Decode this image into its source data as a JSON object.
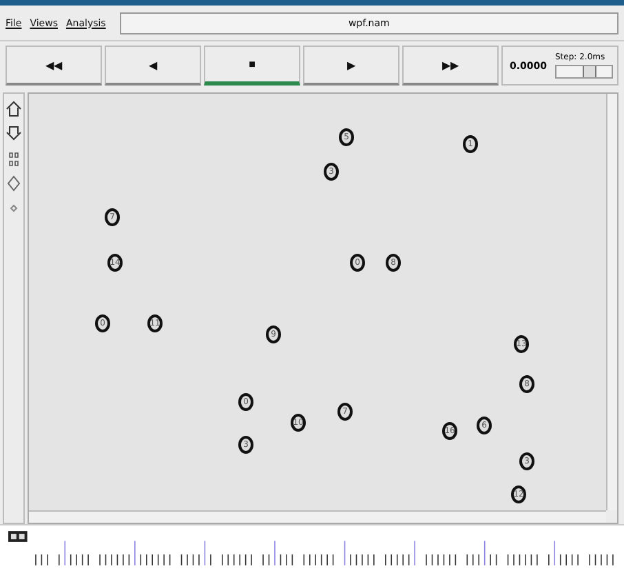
{
  "menu": [
    "File",
    "Views",
    "Analysis"
  ],
  "title": "wpf.nam",
  "controls": [
    {
      "symbol": "◀◀",
      "selected": false
    },
    {
      "symbol": "◀",
      "selected": false
    },
    {
      "symbol": "■",
      "selected": true
    },
    {
      "symbol": "▶",
      "selected": false
    },
    {
      "symbol": "▶▶",
      "selected": false
    }
  ],
  "time": "0.0000",
  "step": {
    "label": "Step: 2.0ms",
    "level": 0.6
  },
  "nodes": [
    {
      "label": "5"
    },
    {
      "label": "1"
    },
    {
      "label": "3"
    },
    {
      "label": "7"
    },
    {
      "label": "14"
    },
    {
      "label": "0"
    },
    {
      "label": "8"
    },
    {
      "label": "0"
    },
    {
      "label": "11"
    },
    {
      "label": "9"
    },
    {
      "label": "13"
    },
    {
      "label": "8"
    },
    {
      "label": "0"
    },
    {
      "label": "10"
    },
    {
      "label": "7"
    },
    {
      "label": "16"
    },
    {
      "label": "6"
    },
    {
      "label": "3"
    },
    {
      "label": "3"
    },
    {
      "label": "12"
    }
  ]
}
